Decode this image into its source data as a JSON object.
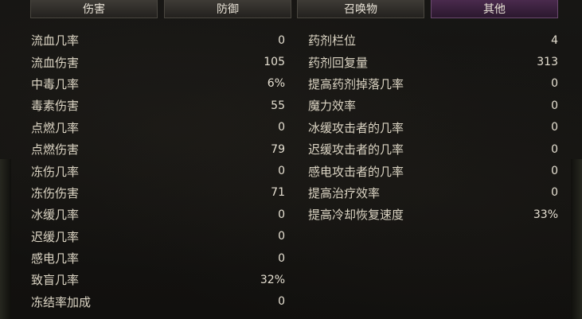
{
  "tabs": [
    {
      "label": "伤害",
      "active": false
    },
    {
      "label": "防御",
      "active": false
    },
    {
      "label": "召唤物",
      "active": false
    },
    {
      "label": "其他",
      "active": true
    }
  ],
  "left_stats": [
    {
      "label": "流血几率",
      "value": "0"
    },
    {
      "label": "流血伤害",
      "value": "105"
    },
    {
      "label": "中毒几率",
      "value": "6%"
    },
    {
      "label": "毒素伤害",
      "value": "55"
    },
    {
      "label": "点燃几率",
      "value": "0"
    },
    {
      "label": "点燃伤害",
      "value": "79"
    },
    {
      "label": "冻伤几率",
      "value": "0"
    },
    {
      "label": "冻伤伤害",
      "value": "71"
    },
    {
      "label": "冰缓几率",
      "value": "0"
    },
    {
      "label": "迟缓几率",
      "value": "0"
    },
    {
      "label": "感电几率",
      "value": "0"
    },
    {
      "label": "致盲几率",
      "value": "32%"
    },
    {
      "label": "冻结率加成",
      "value": "0"
    }
  ],
  "right_stats": [
    {
      "label": "药剂栏位",
      "value": "4"
    },
    {
      "label": "药剂回复量",
      "value": "313"
    },
    {
      "label": "提高药剂掉落几率",
      "value": "0"
    },
    {
      "label": "魔力效率",
      "value": "0"
    },
    {
      "label": "冰缓攻击者的几率",
      "value": "0"
    },
    {
      "label": "迟缓攻击者的几率",
      "value": "0"
    },
    {
      "label": "感电攻击者的几率",
      "value": "0"
    },
    {
      "label": "提高治疗效率",
      "value": "0"
    },
    {
      "label": "提高冷却恢复速度",
      "value": "33%"
    }
  ]
}
